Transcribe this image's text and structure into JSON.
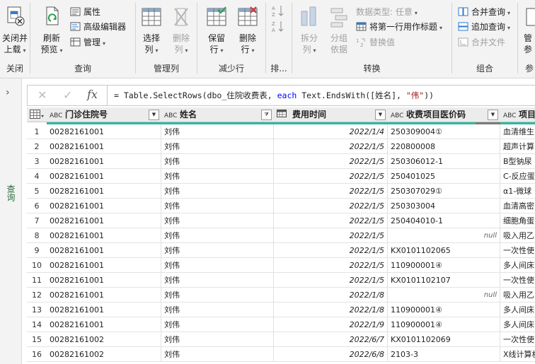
{
  "ribbon": {
    "close_group": {
      "label": "关闭",
      "close_load": [
        "关闭并",
        "上载"
      ]
    },
    "query_group": {
      "label": "查询",
      "refresh": [
        "刷新",
        "预览"
      ],
      "properties": "属性",
      "advanced_editor": "高级编辑器",
      "manage": "管理"
    },
    "manage_cols_group": {
      "label": "管理列",
      "choose_cols": [
        "选择",
        "列"
      ],
      "remove_cols": [
        "删除",
        "列"
      ]
    },
    "reduce_rows_group": {
      "label": "减少行",
      "keep_rows": [
        "保留",
        "行"
      ],
      "remove_rows": [
        "删除",
        "行"
      ]
    },
    "sort_group": {
      "label": "排..."
    },
    "transform_group": {
      "label": "转换",
      "split": [
        "拆分",
        "列"
      ],
      "group_by": [
        "分组",
        "依据"
      ],
      "data_type": "数据类型: 任意",
      "first_row_header": "将第一行用作标题",
      "replace_values": "替换值"
    },
    "combine_group": {
      "label": "组合",
      "merge_queries": "合并查询",
      "append_queries": "追加查询",
      "combine_files": "合并文件"
    },
    "params_group": {
      "label": "参",
      "manage_params": [
        "管",
        "参"
      ]
    }
  },
  "left_pane": {
    "label": "查询"
  },
  "formula_bar": {
    "cancel": "✕",
    "confirm": "✓",
    "fx": "fx",
    "p1": "= Table.SelectRows(dbo_住院收费表, ",
    "kw": "each",
    "p2": " Text.EndsWith([姓名], ",
    "str": "\"伟\"",
    "p3": "))"
  },
  "grid": {
    "type_abc": "ABC",
    "columns": [
      "门诊住院号",
      "姓名",
      "费用时间",
      "收费项目医价码",
      "项目"
    ],
    "null_text": "null",
    "colors": {
      "quality_green": "#2fb8a0",
      "quality_gray": "#7a7a7a",
      "header_bg": "#ececec"
    },
    "rows": [
      {
        "num": "1",
        "id": "00282161001",
        "name": "刘伟",
        "date": "2022/1/4",
        "code": "250309004①",
        "item": "血清维生"
      },
      {
        "num": "2",
        "id": "00282161001",
        "name": "刘伟",
        "date": "2022/1/5",
        "code": "220800008",
        "item": "超声计算"
      },
      {
        "num": "3",
        "id": "00282161001",
        "name": "刘伟",
        "date": "2022/1/5",
        "code": "250306012-1",
        "item": "B型钠尿"
      },
      {
        "num": "4",
        "id": "00282161001",
        "name": "刘伟",
        "date": "2022/1/5",
        "code": "250401025",
        "item": "C-反应蛋"
      },
      {
        "num": "5",
        "id": "00282161001",
        "name": "刘伟",
        "date": "2022/1/5",
        "code": "250307029①",
        "item": "α1-微球"
      },
      {
        "num": "6",
        "id": "00282161001",
        "name": "刘伟",
        "date": "2022/1/5",
        "code": "250303004",
        "item": "血清高密"
      },
      {
        "num": "7",
        "id": "00282161001",
        "name": "刘伟",
        "date": "2022/1/5",
        "code": "250404010-1",
        "item": "细胞角蛋"
      },
      {
        "num": "8",
        "id": "00282161001",
        "name": "刘伟",
        "date": "2022/1/5",
        "code": "",
        "item": "吸入用乙"
      },
      {
        "num": "9",
        "id": "00282161001",
        "name": "刘伟",
        "date": "2022/1/5",
        "code": "KX0101102065",
        "item": "一次性使"
      },
      {
        "num": "10",
        "id": "00282161001",
        "name": "刘伟",
        "date": "2022/1/5",
        "code": "110900001④",
        "item": "多人间床"
      },
      {
        "num": "11",
        "id": "00282161001",
        "name": "刘伟",
        "date": "2022/1/5",
        "code": "KX0101102107",
        "item": "一次性使"
      },
      {
        "num": "12",
        "id": "00282161001",
        "name": "刘伟",
        "date": "2022/1/8",
        "code": "",
        "item": "吸入用乙"
      },
      {
        "num": "13",
        "id": "00282161001",
        "name": "刘伟",
        "date": "2022/1/8",
        "code": "110900001④",
        "item": "多人间床"
      },
      {
        "num": "14",
        "id": "00282161001",
        "name": "刘伟",
        "date": "2022/1/9",
        "code": "110900001④",
        "item": "多人间床"
      },
      {
        "num": "15",
        "id": "00282161002",
        "name": "刘伟",
        "date": "2022/6/7",
        "code": "KX0101102069",
        "item": "一次性使"
      },
      {
        "num": "16",
        "id": "00282161002",
        "name": "刘伟",
        "date": "2022/6/8",
        "code": "2103-3",
        "item": "X线计算机"
      }
    ]
  }
}
